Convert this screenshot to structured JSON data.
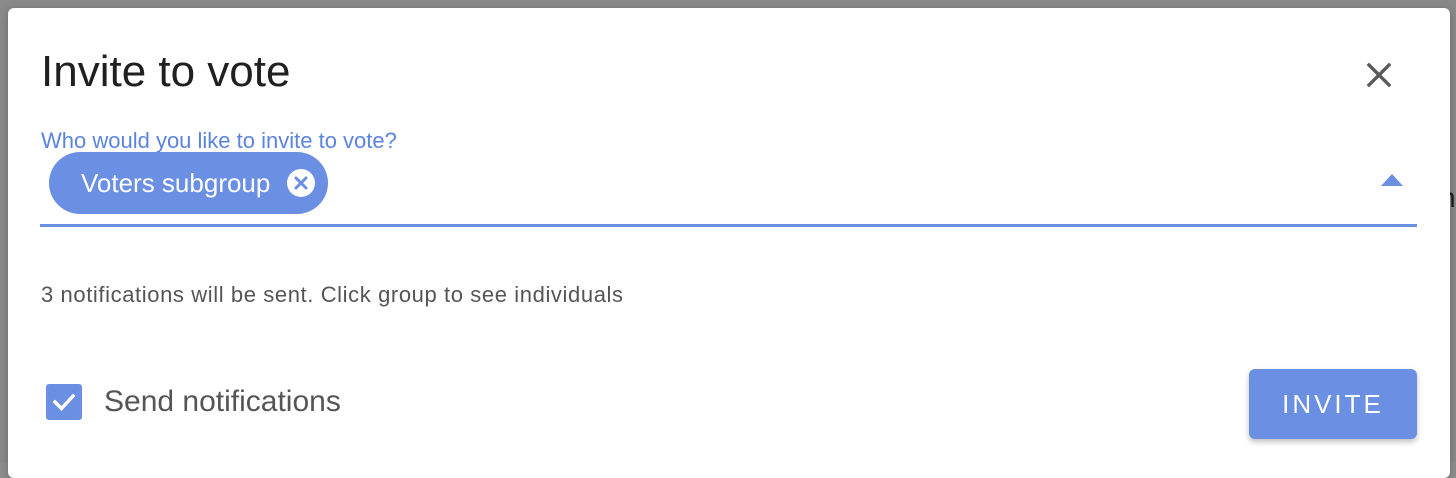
{
  "dialog": {
    "title": "Invite to vote",
    "close_icon": "close-icon"
  },
  "invitees_field": {
    "label": "Who would you like to invite to vote?",
    "chips": [
      {
        "label": "Voters subgroup",
        "remove_icon": "cancel-circle-icon"
      }
    ],
    "dropdown_icon": "arrow-up-icon"
  },
  "helper_text": "3 notifications will be sent. Click group to see individuals",
  "send_notifications": {
    "label": "Send notifications",
    "checked": true,
    "icon": "check-icon"
  },
  "actions": {
    "invite_label": "INVITE"
  },
  "colors": {
    "accent": "#6a8fe3",
    "title_text": "#202020",
    "secondary_text": "#555555"
  }
}
